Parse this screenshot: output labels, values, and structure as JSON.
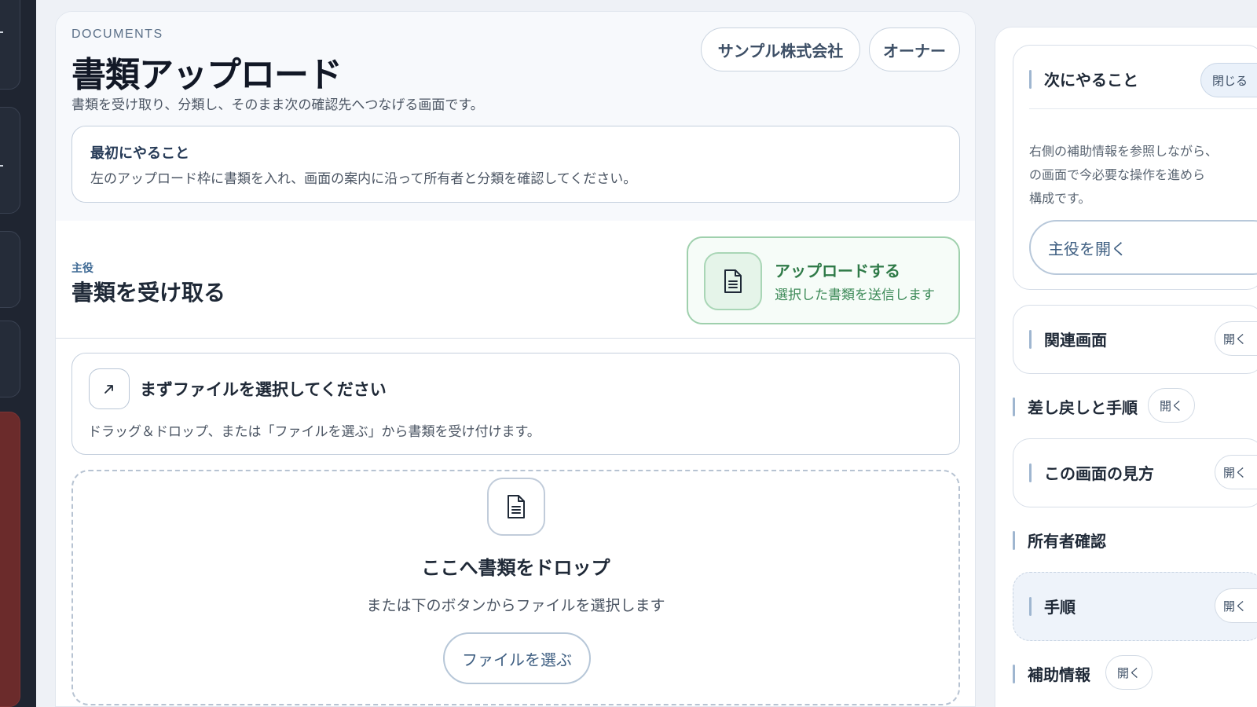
{
  "header": {
    "eyebrow": "DOCUMENTS",
    "title": "書類アップロード",
    "description": "書類を受け取り、分類し、そのまま次の確認先へつなげる画面です。",
    "company": "サンプル株式会社",
    "role": "オーナー"
  },
  "first_step": {
    "title": "最初にやること",
    "description": "左のアップロード枠に書類を入れ、画面の案内に沿って所有者と分類を確認してください。"
  },
  "section": {
    "role_label": "主役",
    "title": "書類を受け取る",
    "upload_button": {
      "title": "アップロードする",
      "subtitle": "選択した書類を送信します"
    }
  },
  "info_card": {
    "title": "まずファイルを選択してください",
    "description": "ドラッグ＆ドロップ、または「ファイルを選ぶ」から書類を受け付けます。"
  },
  "dropzone": {
    "title": "ここへ書類をドロップ",
    "subtitle": "または下のボタンからファイルを選択します",
    "button": "ファイルを選ぶ"
  },
  "side_panel": {
    "next": {
      "title": "次にやること",
      "toggle": "閉じる",
      "description_lines": [
        "右側の補助情報を参照しながら、",
        "の画面で今必要な操作を進めら",
        "構成です。"
      ],
      "open_main": "主役を開く"
    },
    "related": {
      "title": "関連画面",
      "toggle": "開く"
    },
    "remand": {
      "title": "差し戻しと手順",
      "toggle": "開く"
    },
    "howto": {
      "title": "この画面の見方",
      "toggle": "開く"
    },
    "owner": {
      "title": "所有者確認"
    },
    "steps": {
      "title": "手順",
      "toggle": "開く"
    },
    "aux": {
      "title": "補助情報",
      "toggle": "開く"
    }
  },
  "icons": {
    "upload": "document-icon",
    "info": "arrow-up-right-icon",
    "dropzone": "document-icon"
  },
  "colors": {
    "accent_green": "#2f7a48",
    "accent_blue": "#3f5f82",
    "rail": "#1f2531"
  }
}
